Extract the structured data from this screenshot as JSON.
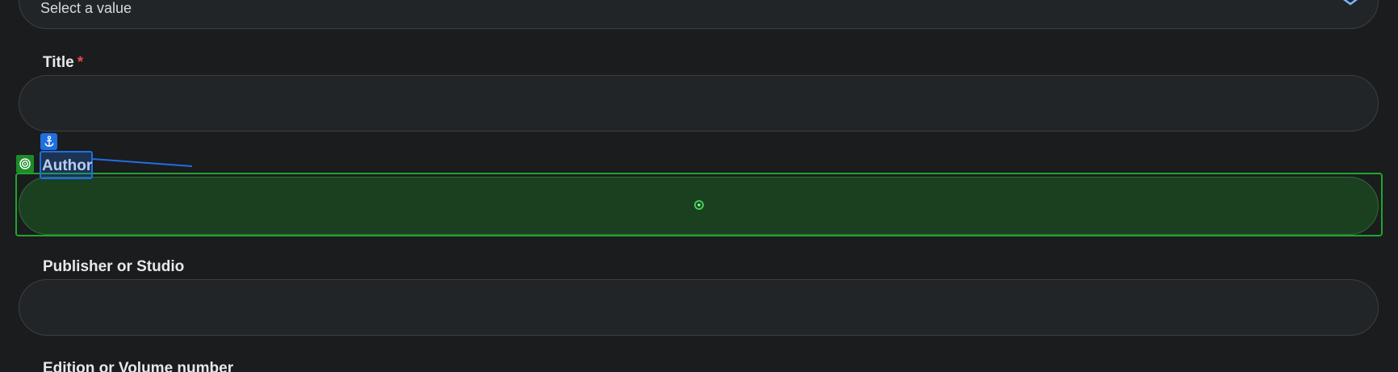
{
  "form": {
    "select": {
      "placeholder": "Select a value",
      "chevron_icon": "chevron-down-icon"
    },
    "title": {
      "label": "Title",
      "required_mark": "*",
      "value": ""
    },
    "author": {
      "label": "Author",
      "value": ""
    },
    "publisher": {
      "label": "Publisher or Studio",
      "value": ""
    },
    "edition": {
      "label": "Edition or Volume number"
    }
  },
  "overlay": {
    "anchor_icon": "anchor-icon",
    "target_icon": "target-icon",
    "center_icon": "crosshair-icon"
  },
  "colors": {
    "background": "#1b1c1e",
    "input_background": "#222527",
    "input_border": "#3c3f43",
    "label": "#e6e8ea",
    "required": "#e5484d",
    "anchor_blue": "#1f6fe0",
    "target_green": "#1ea62b",
    "highlight_fill": "#1b4020",
    "select_chevron": "#7fb4ff"
  }
}
